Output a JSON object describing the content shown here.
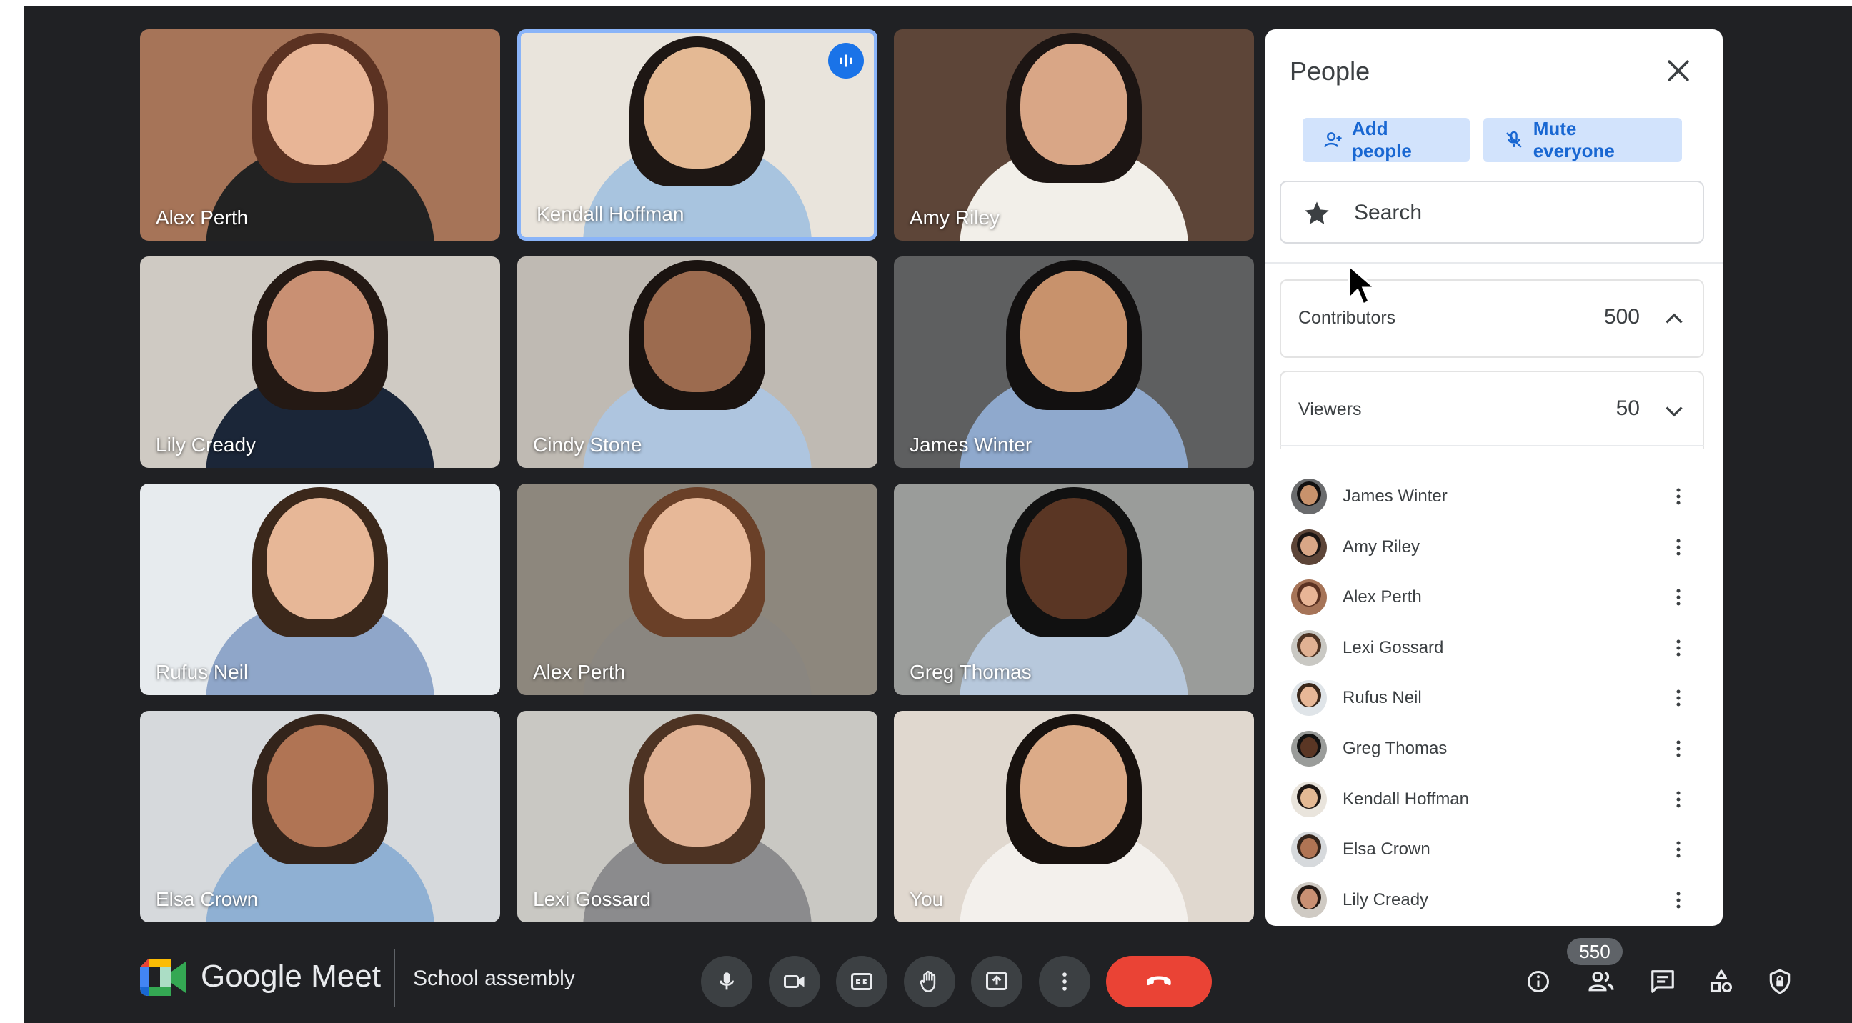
{
  "tiles": [
    {
      "name": "Alex Perth",
      "bg": "#a67458",
      "skin": "#e8b596",
      "hair": "#5b3222",
      "shirt": "#222222"
    },
    {
      "name": "Kendall Hoffman",
      "bg": "#e9e4dc",
      "skin": "#e4b994",
      "hair": "#1e1714",
      "shirt": "#a8c4df",
      "active": true
    },
    {
      "name": "Amy Riley",
      "bg": "#5d4538",
      "skin": "#d9a686",
      "hair": "#1c1513",
      "shirt": "#f2efe9"
    },
    {
      "name": "Lily Cready",
      "bg": "#cfcac3",
      "skin": "#c99073",
      "hair": "#241914",
      "shirt": "#1b2638"
    },
    {
      "name": "Cindy Stone",
      "bg": "#bfbab3",
      "skin": "#9c6b4f",
      "hair": "#1a1310",
      "shirt": "#aec5df"
    },
    {
      "name": "James Winter",
      "bg": "#5e5f60",
      "skin": "#c8926c",
      "hair": "#121010",
      "shirt": "#8fa9cd"
    },
    {
      "name": "Rufus Neil",
      "bg": "#e7ebee",
      "skin": "#e7b797",
      "hair": "#3b281b",
      "shirt": "#8fa6c9"
    },
    {
      "name": "Alex Perth",
      "bg": "#8d877d",
      "skin": "#e7b898",
      "hair": "#6a4028",
      "shirt": "#8a8680"
    },
    {
      "name": "Greg Thomas",
      "bg": "#9a9c9a",
      "skin": "#5a3624",
      "hair": "#111111",
      "shirt": "#b7c8dc"
    },
    {
      "name": "Elsa Crown",
      "bg": "#d6d9dc",
      "skin": "#b07454",
      "hair": "#33241b",
      "shirt": "#8fb0d3"
    },
    {
      "name": "Lexi Gossard",
      "bg": "#c9c8c3",
      "skin": "#e0b193",
      "hair": "#4d3323",
      "shirt": "#8b8b8d"
    },
    {
      "name": "You",
      "bg": "#e0d8cf",
      "skin": "#dcab88",
      "hair": "#18120f",
      "shirt": "#f3f0ec"
    }
  ],
  "panel": {
    "title": "People",
    "add_people_label": "Add people",
    "mute_everyone_label": "Mute everyone",
    "search_placeholder": "Search",
    "contributors_label": "Contributors",
    "contributors_count": "500",
    "viewers_label": "Viewers",
    "viewers_count": "50",
    "people": [
      {
        "name": "James Winter",
        "skin": "#c8926c",
        "hair": "#121010",
        "bg": "#6a6b6d"
      },
      {
        "name": "Amy Riley",
        "skin": "#d9a686",
        "hair": "#1c1513",
        "bg": "#5d4538"
      },
      {
        "name": "Alex Perth",
        "skin": "#e8b596",
        "hair": "#5b3222",
        "bg": "#a67458"
      },
      {
        "name": "Lexi Gossard",
        "skin": "#e0b193",
        "hair": "#4d3323",
        "bg": "#c9c8c3"
      },
      {
        "name": "Rufus Neil",
        "skin": "#e7b797",
        "hair": "#3b281b",
        "bg": "#dfe4e8"
      },
      {
        "name": "Greg Thomas",
        "skin": "#5a3624",
        "hair": "#111111",
        "bg": "#9a9c9a"
      },
      {
        "name": "Kendall Hoffman",
        "skin": "#e4b994",
        "hair": "#1e1714",
        "bg": "#e9e4dc"
      },
      {
        "name": "Elsa Crown",
        "skin": "#b07454",
        "hair": "#33241b",
        "bg": "#d6d9dc"
      },
      {
        "name": "Lily Cready",
        "skin": "#c99073",
        "hair": "#241914",
        "bg": "#cfcac3"
      }
    ]
  },
  "bottom_bar": {
    "brand": "Google Meet",
    "meeting_title": "School assembly",
    "participant_count": "550"
  },
  "colors": {
    "background": "#202124",
    "accent": "#1a73e8",
    "end_call": "#ea4335",
    "active_tile_border": "#8ab4f8",
    "pill_bg": "#d2e3fc"
  },
  "icons": [
    "mic-icon",
    "camera-icon",
    "captions-icon",
    "raise-hand-icon",
    "present-icon",
    "more-options-icon",
    "end-call-icon",
    "info-icon",
    "people-icon",
    "chat-icon",
    "activities-icon",
    "host-controls-icon"
  ]
}
